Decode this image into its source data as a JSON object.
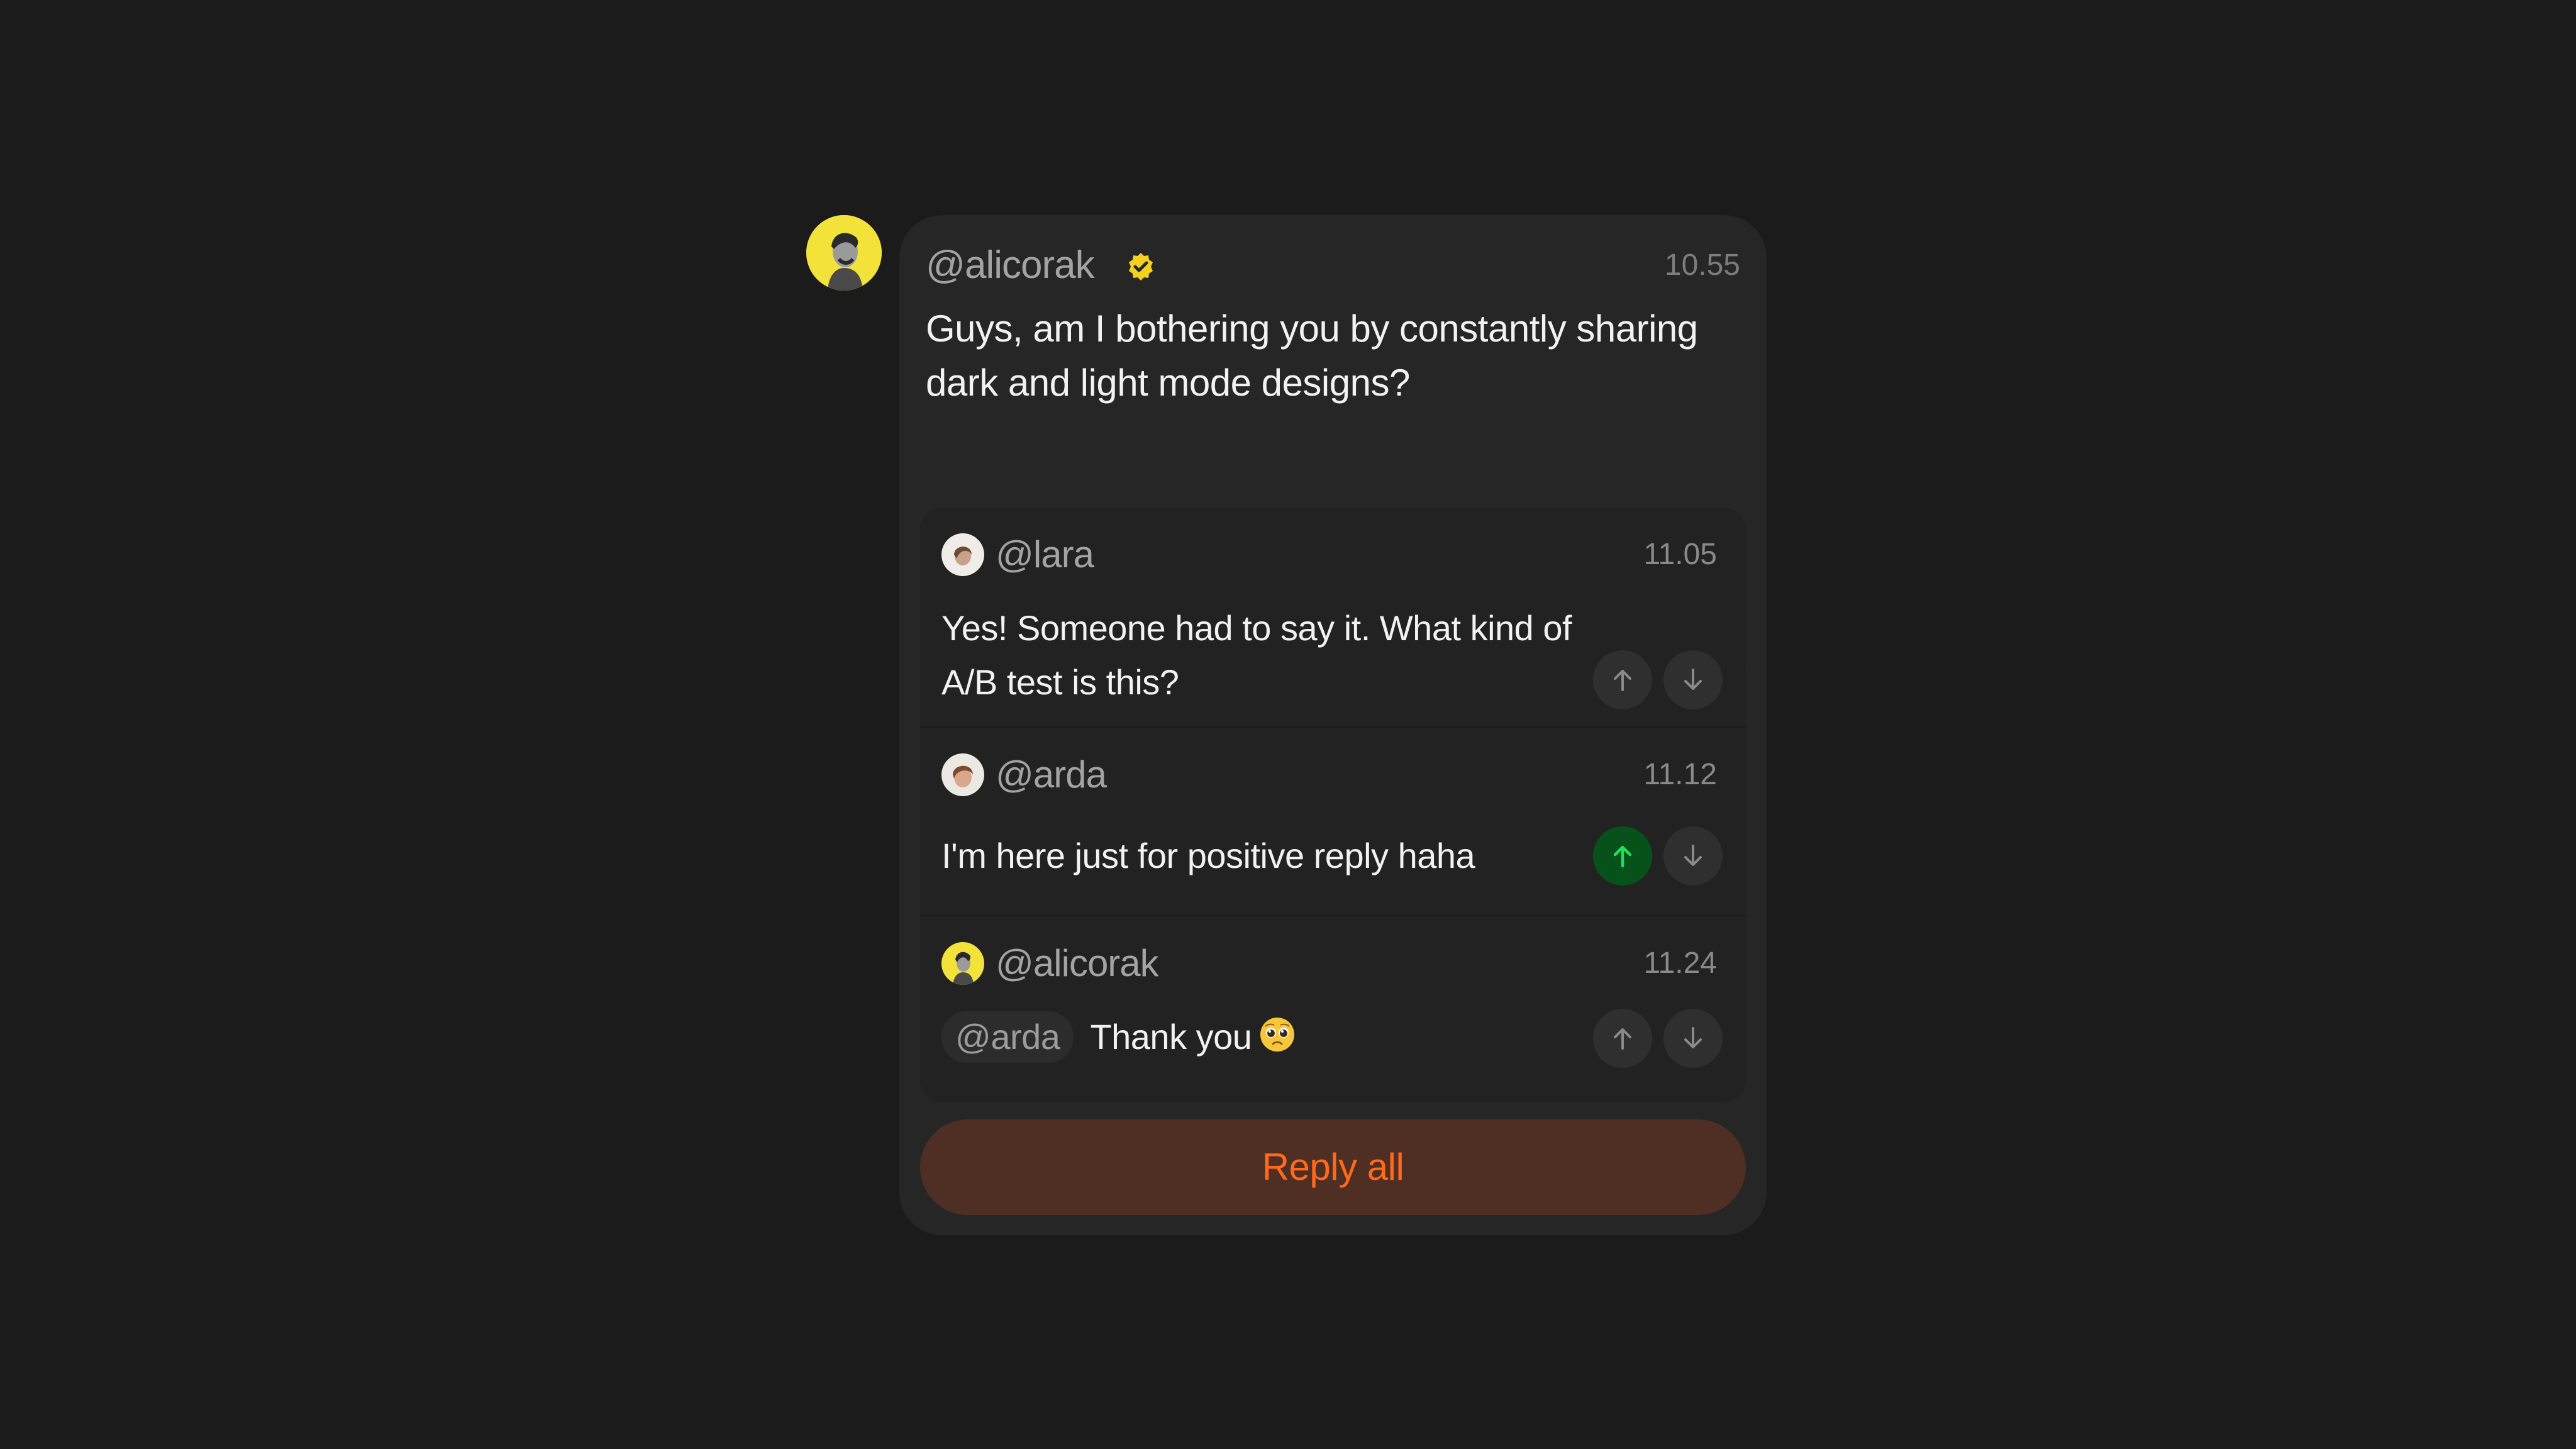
{
  "post": {
    "author": "@alicorak",
    "time": "10.55",
    "text": "Guys, am I bothering you by constantly sharing dark and light mode designs?",
    "reply_count": "3"
  },
  "replies": [
    {
      "author": "@lara",
      "time": "11.05",
      "text": "Yes! Someone had to say it. What kind of A/B test is this?",
      "upvoted": false
    },
    {
      "author": "@arda",
      "time": "11.12",
      "text": "I'm here just for positive reply haha",
      "upvoted": true
    },
    {
      "author": "@alicorak",
      "time": "11.24",
      "mention": "@arda",
      "text": "Thank you",
      "emoji": "pleading-face-emoji",
      "upvoted": false
    }
  ],
  "actions": {
    "reply_all_label": "Reply all"
  },
  "colors": {
    "background": "#1b1b1b",
    "card": "#262626",
    "accent": "#ff6a1a",
    "upvote_active": "#07511a",
    "upvote_arrow_active": "#20e05a",
    "avatar_yellow": "#f2e23a"
  },
  "icons": {
    "verified": "verified-badge-icon",
    "upvote": "arrow-up-icon",
    "downvote": "arrow-down-icon",
    "collapse": "chevron-up-icon"
  }
}
